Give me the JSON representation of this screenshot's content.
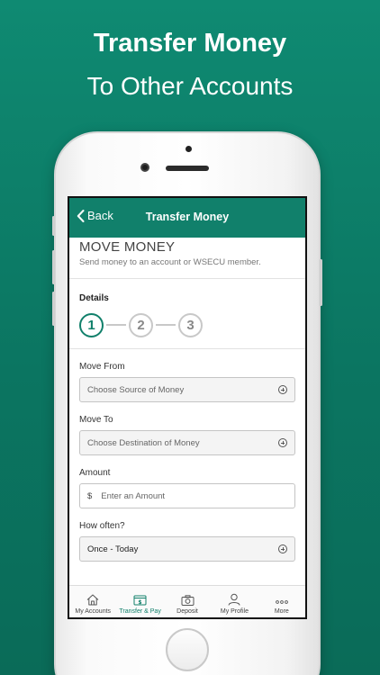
{
  "promo": {
    "title": "Transfer Money",
    "subtitle": "To Other Accounts"
  },
  "nav": {
    "back_label": "Back",
    "title": "Transfer Money"
  },
  "move_money": {
    "title": "MOVE MONEY",
    "description": "Send money to an account or WSECU member."
  },
  "details": {
    "label": "Details",
    "steps": [
      "1",
      "2",
      "3"
    ],
    "active_step": 1
  },
  "form": {
    "move_from": {
      "label": "Move From",
      "placeholder": "Choose Source of Money"
    },
    "move_to": {
      "label": "Move To",
      "placeholder": "Choose Destination of Money"
    },
    "amount": {
      "label": "Amount",
      "currency": "$",
      "placeholder": "Enter an Amount"
    },
    "frequency": {
      "label": "How often?",
      "value": "Once - Today"
    }
  },
  "tabs": [
    {
      "label": "My Accounts",
      "icon": "home-icon"
    },
    {
      "label": "Transfer & Pay",
      "icon": "transfer-icon",
      "active": true
    },
    {
      "label": "Deposit",
      "icon": "camera-icon"
    },
    {
      "label": "My Profile",
      "icon": "person-icon"
    },
    {
      "label": "More",
      "icon": "ellipsis-icon"
    }
  ],
  "colors": {
    "brand_green": "#11806b",
    "background_green": "#0b7561"
  }
}
